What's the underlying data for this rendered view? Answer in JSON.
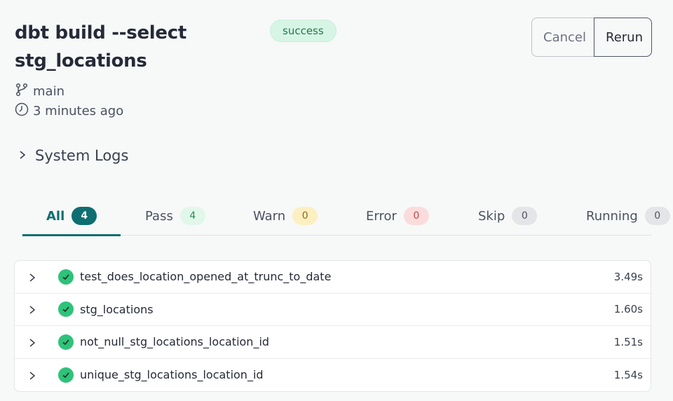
{
  "header": {
    "title": "dbt build --select stg_locations",
    "status": "success",
    "cancel_label": "Cancel",
    "rerun_label": "Rerun",
    "branch": "main",
    "time_ago": "3 minutes ago"
  },
  "system_logs": {
    "label": "System Logs"
  },
  "tabs": [
    {
      "label": "All",
      "count": "4"
    },
    {
      "label": "Pass",
      "count": "4"
    },
    {
      "label": "Warn",
      "count": "0"
    },
    {
      "label": "Error",
      "count": "0"
    },
    {
      "label": "Skip",
      "count": "0"
    },
    {
      "label": "Running",
      "count": "0"
    }
  ],
  "results": [
    {
      "name": "test_does_location_opened_at_trunc_to_date",
      "duration": "3.49s",
      "status": "pass"
    },
    {
      "name": "stg_locations",
      "duration": "1.60s",
      "status": "pass"
    },
    {
      "name": "not_null_stg_locations_location_id",
      "duration": "1.51s",
      "status": "pass"
    },
    {
      "name": "unique_stg_locations_location_id",
      "duration": "1.54s",
      "status": "pass"
    }
  ],
  "colors": {
    "accent": "#0f6e71",
    "success": "#2fc27a",
    "success_badge_bg": "#d7f5e4"
  },
  "icons": {
    "branch": "git-branch-icon",
    "clock": "clock-icon",
    "expand": "chevron-right-icon",
    "pass": "check-circle-icon"
  }
}
